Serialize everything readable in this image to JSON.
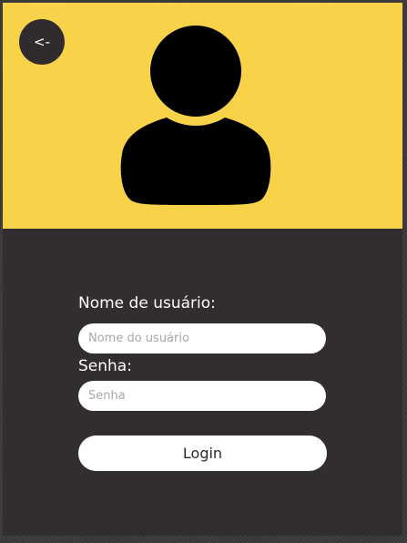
{
  "colors": {
    "header_background": "#f8d34a",
    "panel_background": "#312d30",
    "back_button_background": "#2f2b2e",
    "avatar_fill": "#000000"
  },
  "header": {
    "back_button_label": "<-",
    "avatar_icon": "user-silhouette-icon"
  },
  "form": {
    "username_label": "Nome de usuário:",
    "username_placeholder": "Nome do usuário",
    "password_label": "Senha:",
    "password_placeholder": "Senha",
    "login_label": "Login"
  }
}
